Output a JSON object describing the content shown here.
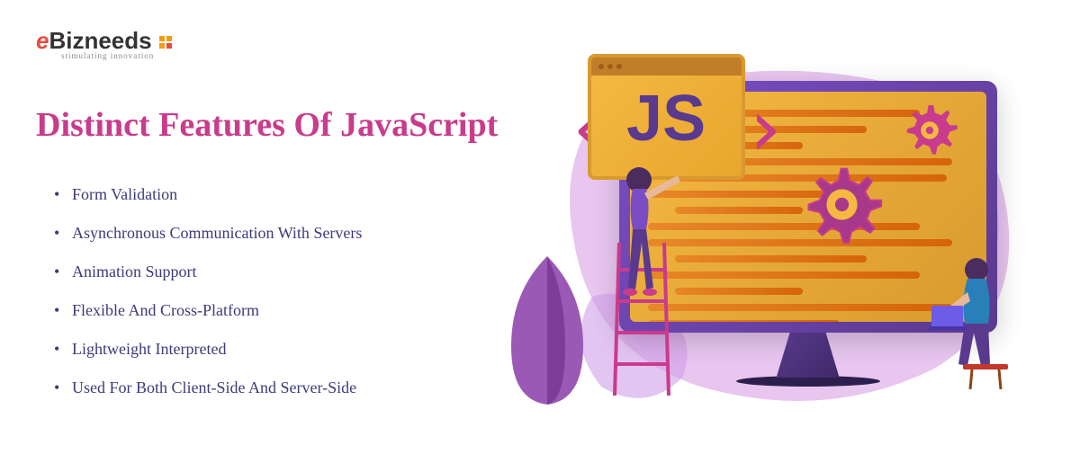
{
  "logo": {
    "prefix": "e",
    "name": "Bizneeds",
    "tagline": "stimulating innovation"
  },
  "title": "Distinct Features Of JavaScript",
  "features": [
    "Form Validation",
    "Asynchronous Communication With Servers",
    "Animation Support",
    "Flexible And Cross-Platform",
    "Lightweight Interpreted",
    "Used For Both Client-Side And Server-Side"
  ],
  "illustration": {
    "badge_text": "JS",
    "bracket_left": "‹",
    "bracket_right": "›"
  },
  "colors": {
    "title": "#c93b8c",
    "text": "#3d3a7a",
    "blob": "#e8c6f0",
    "monitor": "#5a3a8e",
    "screen": "#f5b942"
  }
}
